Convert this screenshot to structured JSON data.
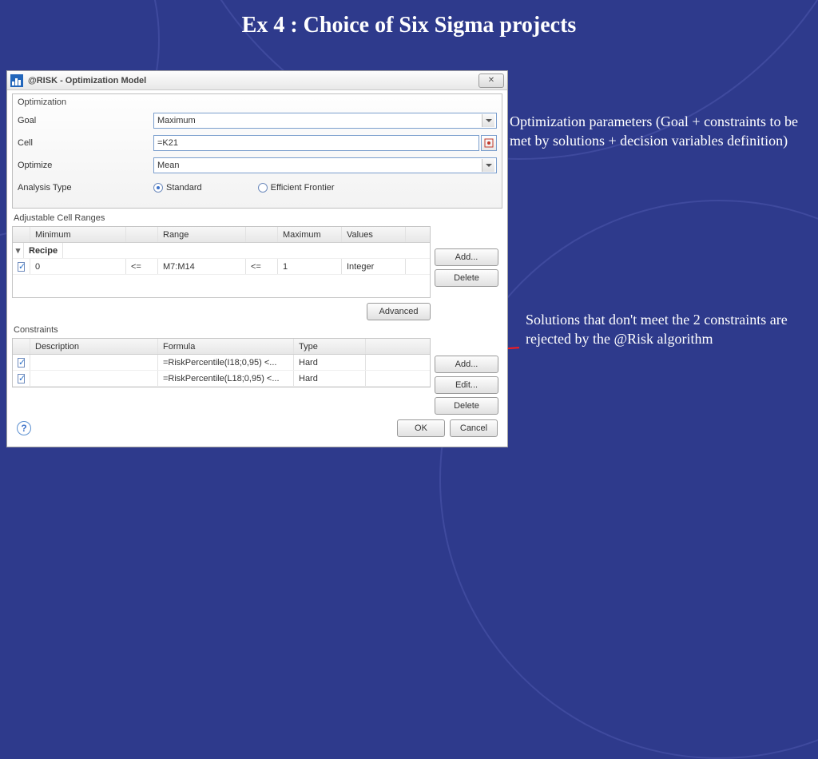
{
  "slide": {
    "title": "Ex 4 : Choice of Six Sigma projects",
    "annotation1": "Optimization parameters (Goal  + constraints to be met by solutions + decision variables definition)",
    "annotation2": "Solutions that don't meet the 2 constraints are rejected by the @Risk algorithm"
  },
  "dialog": {
    "title": "@RISK - Optimization Model",
    "optimization": {
      "section_label": "Optimization",
      "goal_label": "Goal",
      "goal_value": "Maximum",
      "cell_label": "Cell",
      "cell_value": "=K21",
      "optimize_label": "Optimize",
      "optimize_value": "Mean",
      "analysis_label": "Analysis Type",
      "radio_standard": "Standard",
      "radio_frontier": "Efficient Frontier"
    },
    "adjustable": {
      "section_label": "Adjustable Cell Ranges",
      "headers": {
        "minimum": "Minimum",
        "range": "Range",
        "maximum": "Maximum",
        "values": "Values"
      },
      "group_name": "Recipe",
      "row": {
        "min": "0",
        "op1": "<=",
        "range": "M7:M14",
        "op2": "<=",
        "max": "1",
        "values": "Integer"
      },
      "btn_add": "Add...",
      "btn_delete": "Delete",
      "btn_advanced": "Advanced"
    },
    "constraints": {
      "section_label": "Constraints",
      "headers": {
        "description": "Description",
        "formula": "Formula",
        "type": "Type"
      },
      "rows": [
        {
          "description": "",
          "formula": "=RiskPercentile(I18;0,95) <...",
          "type": "Hard"
        },
        {
          "description": "",
          "formula": "=RiskPercentile(L18;0,95) <...",
          "type": "Hard"
        }
      ],
      "btn_add": "Add...",
      "btn_edit": "Edit...",
      "btn_delete": "Delete"
    },
    "footer": {
      "ok": "OK",
      "cancel": "Cancel"
    }
  }
}
